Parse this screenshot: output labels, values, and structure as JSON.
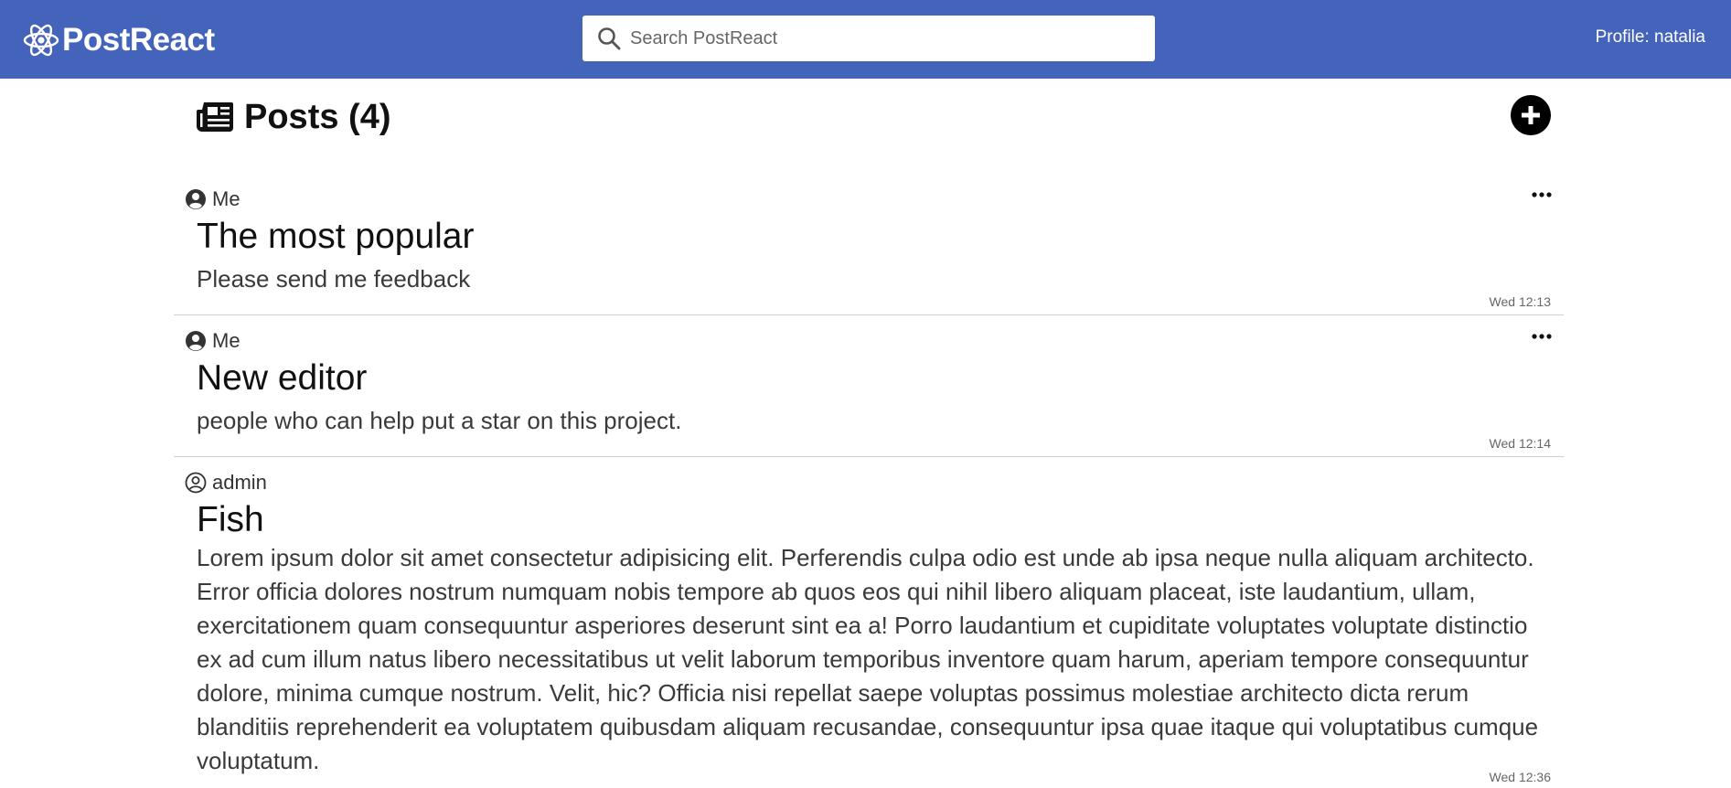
{
  "header": {
    "brand": "PostReact",
    "search_placeholder": "Search PostReact",
    "profile": "Profile: natalia",
    "bg_color": "#4463bb"
  },
  "page": {
    "title": "Posts (4)"
  },
  "posts": [
    {
      "author": "Me",
      "author_icon": "user-circle-solid-icon",
      "title": "The most popular",
      "body": "Please send me feedback",
      "time": "Wed 12:13",
      "has_menu": true
    },
    {
      "author": "Me",
      "author_icon": "user-circle-solid-icon",
      "title": "New editor",
      "body": "people who can help put a star on this project.",
      "time": "Wed 12:14",
      "has_menu": true
    },
    {
      "author": "admin",
      "author_icon": "user-circle-outline-icon",
      "title": "Fish",
      "body": "Lorem ipsum dolor sit amet consectetur adipisicing elit. Perferendis culpa odio est unde ab ipsa neque nulla aliquam architecto. Error officia dolores nostrum numquam nobis tempore ab quos eos qui nihil libero aliquam placeat, iste laudantium, ullam, exercitationem quam consequuntur asperiores deserunt sint ea a! Porro laudantium et cupiditate voluptates voluptate distinctio ex ad cum illum natus libero necessitatibus ut velit laborum temporibus inventore quam harum, aperiam tempore consequuntur dolore, minima cumque nostrum. Velit, hic? Officia nisi repellat saepe voluptas possimus molestiae architecto dicta rerum blanditiis reprehenderit ea voluptatem quibusdam aliquam recusandae, consequuntur ipsa quae itaque qui voluptatibus cumque voluptatum.",
      "time": "Wed 12:36",
      "has_menu": false
    }
  ]
}
